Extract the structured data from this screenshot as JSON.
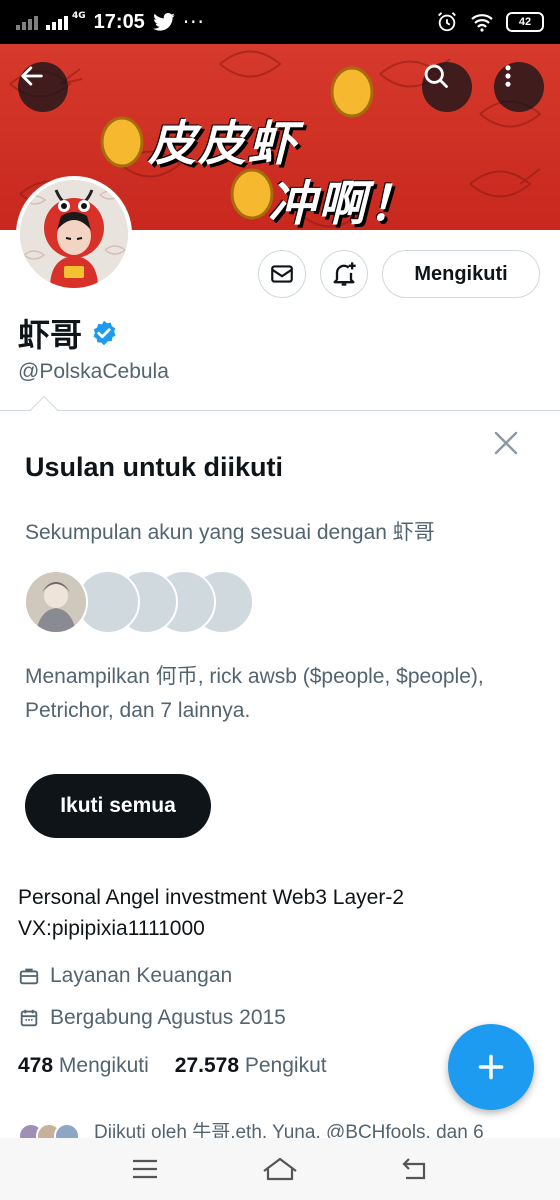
{
  "status_bar": {
    "network": "4G",
    "time": "17:05",
    "battery": "42"
  },
  "banner": {
    "line1": "皮皮虾",
    "line2": "冲啊！"
  },
  "actions": {
    "follow_label": "Mengikuti"
  },
  "profile": {
    "name": "虾哥",
    "handle": "@PolskaCebula",
    "bio_line1": "Personal Angel investment Web3 Layer-2",
    "bio_line2": "VX:pipipixia1111000",
    "category": "Layanan Keuangan",
    "joined": "Bergabung Agustus 2015",
    "following_count": "478",
    "following_label": "Mengikuti",
    "followers_count": "27.578",
    "followers_label": "Pengikut",
    "followed_by": "Diikuti oleh 牛哥.eth, Yuna, @BCHfools, dan 6"
  },
  "suggestions": {
    "title": "Usulan untuk diikuti",
    "subtitle": "Sekumpulan akun yang sesuai dengan 虾哥",
    "description": "Menampilkan 何币, rick awsb ($people, $people), Petrichor, dan 7 lainnya.",
    "follow_all_label": "Ikuti semua"
  },
  "colors": {
    "accent": "#1d9bf0",
    "banner_red": "#d63a2c",
    "text_primary": "#0f1419",
    "text_secondary": "#536471"
  }
}
